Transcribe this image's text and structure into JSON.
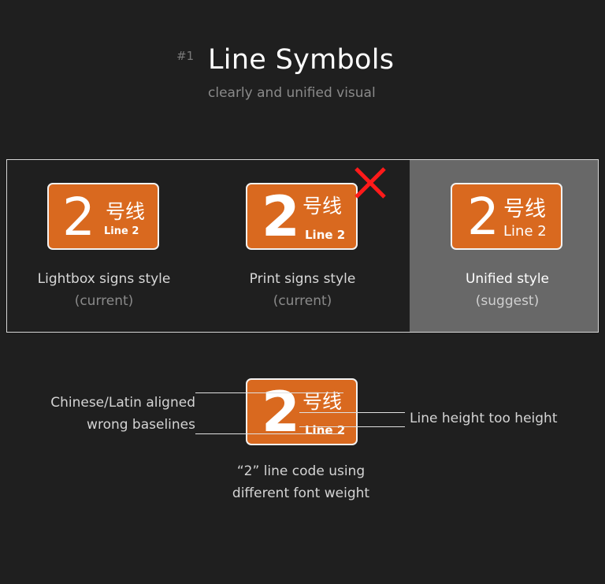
{
  "header": {
    "number": "#1",
    "title": "Line Symbols",
    "subtitle": "clearly and unified visual"
  },
  "badge": {
    "code": "2",
    "chinese": "号线",
    "latin": "Line 2",
    "color": "#d9691f"
  },
  "variants": [
    {
      "name": "Lightbox signs style",
      "status": "(current)"
    },
    {
      "name": "Print signs style",
      "status": "(current)",
      "rejected": true
    },
    {
      "name": "Unified style",
      "status": "(suggest)",
      "highlighted": true
    }
  ],
  "annotations": {
    "left_line1": "Chinese/Latin aligned",
    "left_line2": "wrong baselines",
    "right": "Line height too height",
    "bottom_line1": "“2” line code using",
    "bottom_line2": "different font weight"
  }
}
